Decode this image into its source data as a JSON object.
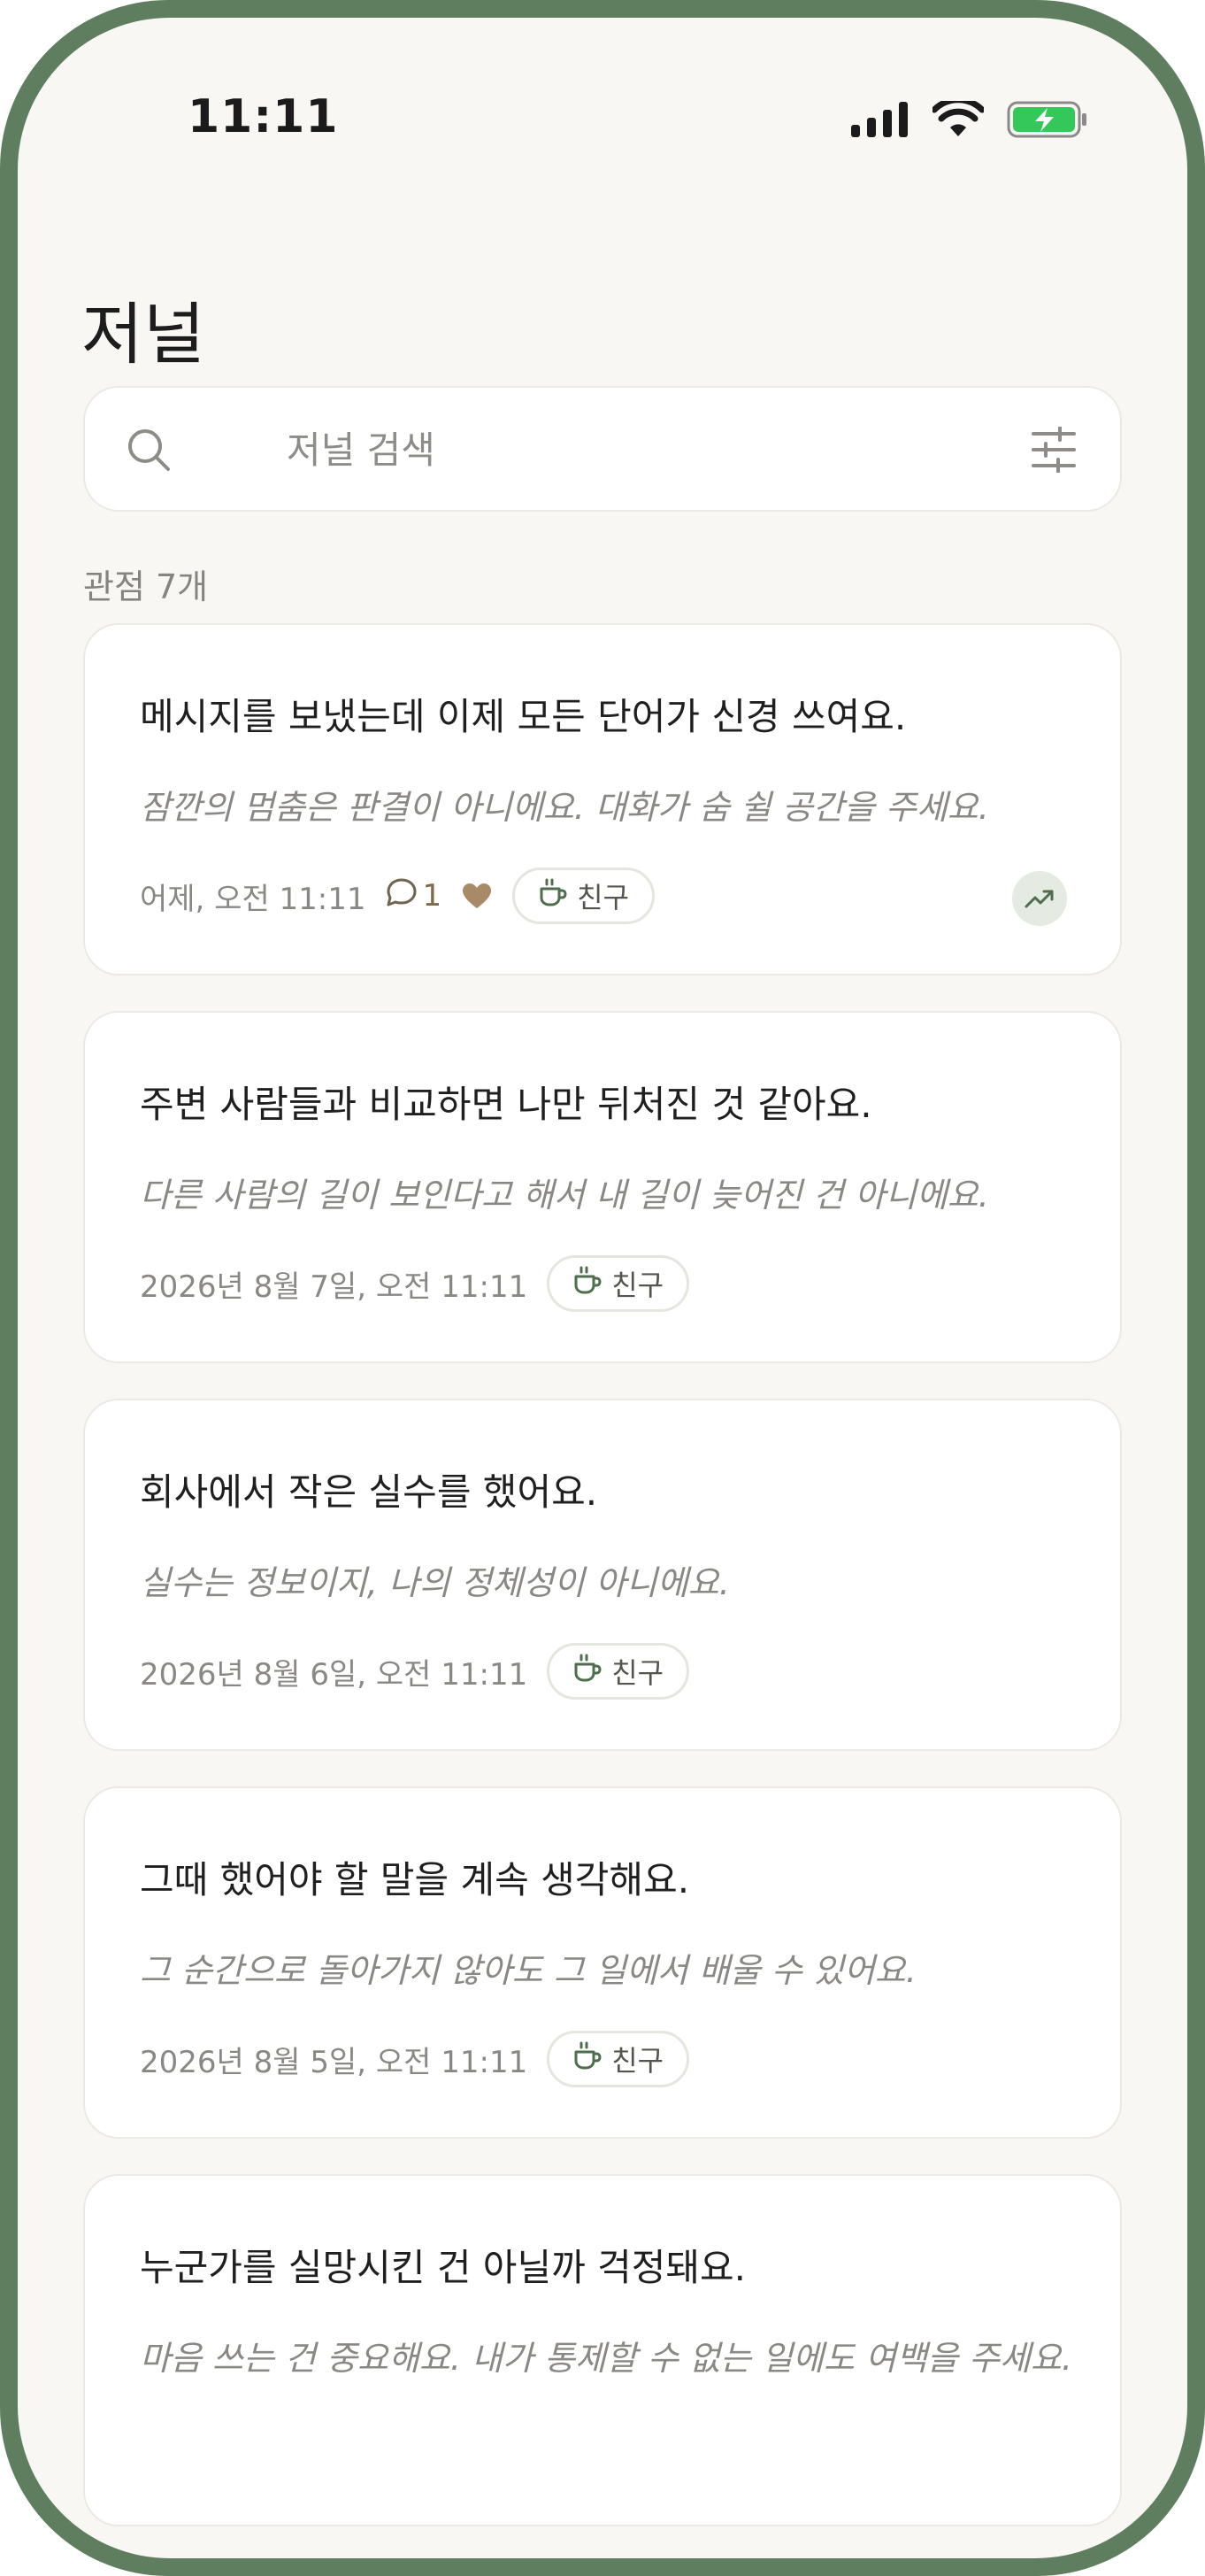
{
  "status": {
    "time": "11:11"
  },
  "header": {
    "title": "저널"
  },
  "search": {
    "placeholder": "저널 검색"
  },
  "summary": {
    "count_label": "관점 7개"
  },
  "entries": [
    {
      "text": "메시지를 보냈는데 이제 모든 단어가 신경 쓰여요.",
      "reframe": "잠깐의 멈춤은 판결이 아니에요. 대화가 숨 쉴 공간을 주세요.",
      "date": "어제, 오전 11:11",
      "comments": "1",
      "tag": "친구"
    },
    {
      "text": "주변 사람들과 비교하면 나만 뒤처진 것 같아요.",
      "reframe": "다른 사람의 길이 보인다고 해서 내 길이 늦어진 건 아니에요.",
      "date": "2026년 8월 7일, 오전 11:11",
      "tag": "친구"
    },
    {
      "text": "회사에서 작은 실수를 했어요.",
      "reframe": "실수는 정보이지, 나의 정체성이 아니에요.",
      "date": "2026년 8월 6일, 오전 11:11",
      "tag": "친구"
    },
    {
      "text": "그때 했어야 할 말을 계속 생각해요.",
      "reframe": "그 순간으로 돌아가지 않아도 그 일에서 배울 수 있어요.",
      "date": "2026년 8월 5일, 오전 11:11",
      "tag": "친구"
    },
    {
      "text": "누군가를 실망시킨 건 아닐까 걱정돼요.",
      "reframe": "마음 쓰는 건 중요해요. 내가 통제할 수 없는 일에도 여백을 주세요."
    }
  ],
  "colors": {
    "frame": "#5f7e5f",
    "background": "#f8f7f3",
    "accent_green": "#4e6e4e",
    "heart": "#a88a68"
  },
  "icons": [
    "search-icon",
    "filter-icon",
    "comment-icon",
    "heart-icon",
    "coffee-icon",
    "trending-up-icon"
  ]
}
